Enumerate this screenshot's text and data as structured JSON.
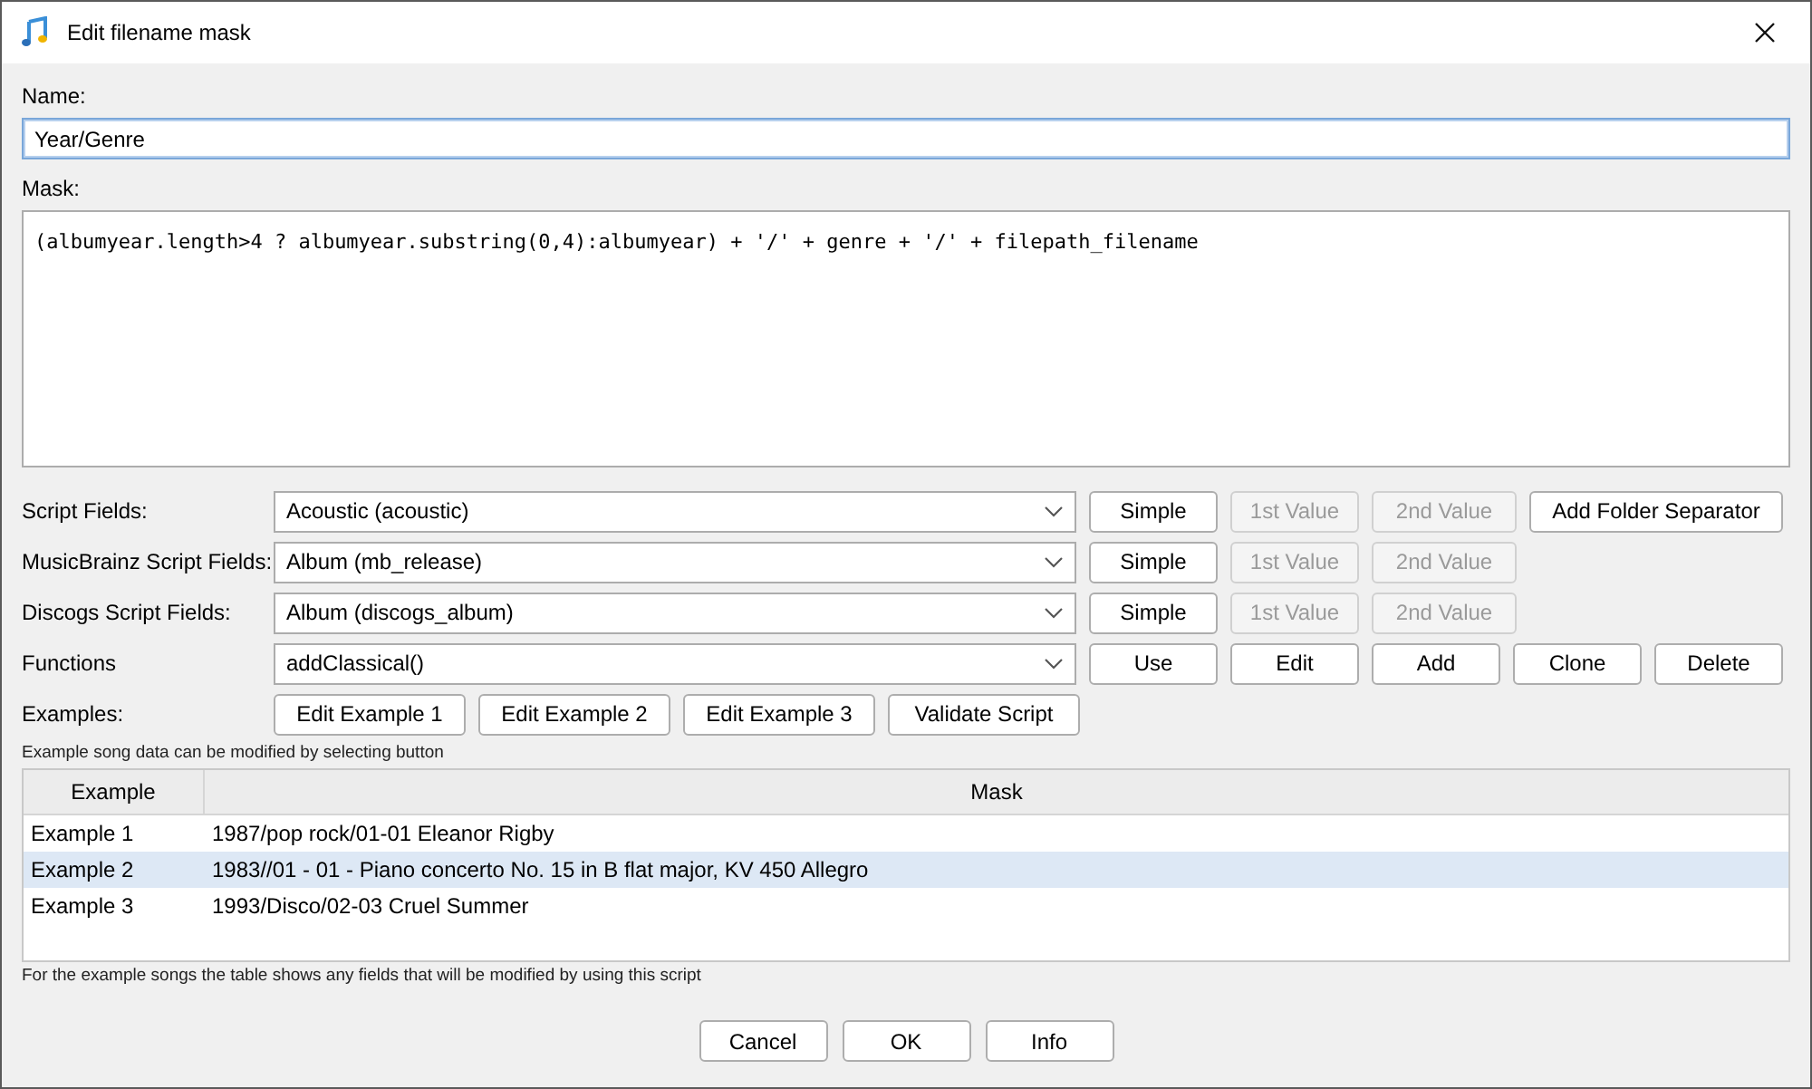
{
  "window": {
    "title": "Edit filename mask"
  },
  "name": {
    "label": "Name:",
    "value": "Year/Genre"
  },
  "mask": {
    "label": "Mask:",
    "value": "(albumyear.length>4 ? albumyear.substring(0,4):albumyear) + '/' + genre + '/' + filepath_filename"
  },
  "field_rows": [
    {
      "label": "Script Fields:",
      "value": "Acoustic (acoustic)",
      "buttons": [
        {
          "label": "Simple",
          "disabled": false
        },
        {
          "label": "1st Value",
          "disabled": true
        },
        {
          "label": "2nd Value",
          "disabled": true
        },
        {
          "label": "Add Folder Separator",
          "disabled": false
        }
      ]
    },
    {
      "label": "MusicBrainz Script Fields:",
      "value": "Album (mb_release)",
      "buttons": [
        {
          "label": "Simple",
          "disabled": false
        },
        {
          "label": "1st Value",
          "disabled": true
        },
        {
          "label": "2nd Value",
          "disabled": true
        }
      ]
    },
    {
      "label": "Discogs Script Fields:",
      "value": "Album (discogs_album)",
      "buttons": [
        {
          "label": "Simple",
          "disabled": false
        },
        {
          "label": "1st Value",
          "disabled": true
        },
        {
          "label": "2nd Value",
          "disabled": true
        }
      ]
    },
    {
      "label": "Functions",
      "value": "addClassical()",
      "buttons": [
        {
          "label": "Use",
          "disabled": false
        },
        {
          "label": "Edit",
          "disabled": false
        },
        {
          "label": "Add",
          "disabled": false
        },
        {
          "label": "Clone",
          "disabled": false
        },
        {
          "label": "Delete",
          "disabled": false
        }
      ]
    }
  ],
  "examples": {
    "label": "Examples:",
    "buttons": [
      "Edit Example 1",
      "Edit Example 2",
      "Edit Example 3",
      "Validate Script"
    ],
    "hint": "Example song data can be modified by selecting button"
  },
  "table": {
    "columns": [
      "Example",
      "Mask"
    ],
    "rows": [
      {
        "example": "Example 1",
        "mask": "1987/pop rock/01-01 Eleanor Rigby",
        "selected": false
      },
      {
        "example": "Example 2",
        "mask": "1983//01 - 01 - Piano concerto No. 15 in B flat major, KV 450 Allegro",
        "selected": true
      },
      {
        "example": "Example 3",
        "mask": "1993/Disco/02-03 Cruel Summer",
        "selected": false
      }
    ]
  },
  "footer_note": "For the example songs the table shows any fields that will be modified by using this script",
  "buttons": [
    "Cancel",
    "OK",
    "Info"
  ]
}
